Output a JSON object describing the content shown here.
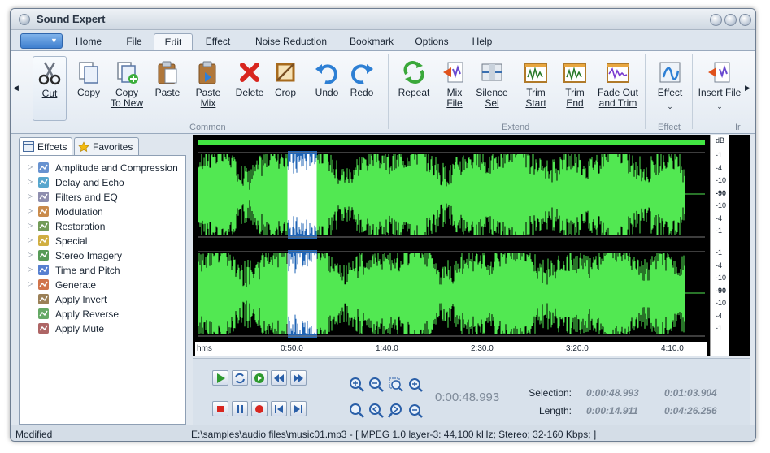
{
  "window": {
    "title": "Sound Expert"
  },
  "menu": {
    "tabs": [
      {
        "label": "Home"
      },
      {
        "label": "File"
      },
      {
        "label": "Edit"
      },
      {
        "label": "Effect"
      },
      {
        "label": "Noise Reduction"
      },
      {
        "label": "Bookmark"
      },
      {
        "label": "Options"
      },
      {
        "label": "Help"
      }
    ],
    "active_tab": "Edit"
  },
  "ribbon": {
    "buttons": [
      {
        "label": "Cut",
        "icon": "scissors-icon"
      },
      {
        "label": "Copy",
        "icon": "copy-icon"
      },
      {
        "label": "Copy To New",
        "line1": "Copy",
        "line2": "To New",
        "icon": "copy-to-new-icon"
      },
      {
        "label": "Paste",
        "icon": "paste-icon"
      },
      {
        "label": "Paste Mix",
        "line1": "Paste",
        "line2": "Mix",
        "icon": "paste-mix-icon"
      },
      {
        "label": "Delete",
        "icon": "delete-icon"
      },
      {
        "label": "Crop",
        "icon": "crop-icon"
      },
      {
        "label": "Undo",
        "icon": "undo-icon"
      },
      {
        "label": "Redo",
        "icon": "redo-icon"
      },
      {
        "label": "Repeat",
        "icon": "repeat-icon"
      },
      {
        "label": "Mix File",
        "line1": "Mix",
        "line2": "File",
        "icon": "mix-file-icon"
      },
      {
        "label": "Silence Sel",
        "line1": "Silence",
        "line2": "Sel",
        "icon": "silence-icon"
      },
      {
        "label": "Trim Start",
        "line1": "Trim",
        "line2": "Start",
        "icon": "trim-start-icon"
      },
      {
        "label": "Trim End",
        "line1": "Trim",
        "line2": "End",
        "icon": "trim-end-icon"
      },
      {
        "label": "Fade Out and Trim",
        "line1": "Fade Out",
        "line2": "and Trim",
        "icon": "fade-out-icon"
      },
      {
        "label": "Effect",
        "icon": "effect-icon"
      },
      {
        "label": "Insert File",
        "icon": "insert-file-icon"
      }
    ],
    "groups": [
      {
        "label": "Common"
      },
      {
        "label": "Extend"
      },
      {
        "label": "Effect"
      },
      {
        "label": "Ir"
      }
    ]
  },
  "side_panel": {
    "tabs": [
      {
        "label": "Effcets"
      },
      {
        "label": "Favorites"
      }
    ],
    "tree": [
      {
        "label": "Amplitude and Compression",
        "expandable": true,
        "icon": "amplitude-icon"
      },
      {
        "label": "Delay and Echo",
        "expandable": true,
        "icon": "delay-icon"
      },
      {
        "label": "Filters and EQ",
        "expandable": true,
        "icon": "filter-icon"
      },
      {
        "label": "Modulation",
        "expandable": true,
        "icon": "modulation-icon"
      },
      {
        "label": "Restoration",
        "expandable": true,
        "icon": "restoration-icon"
      },
      {
        "label": "Special",
        "expandable": true,
        "icon": "special-icon"
      },
      {
        "label": "Stereo Imagery",
        "expandable": true,
        "icon": "stereo-icon"
      },
      {
        "label": "Time and Pitch",
        "expandable": true,
        "icon": "time-pitch-icon"
      },
      {
        "label": "Generate",
        "expandable": true,
        "icon": "generate-icon"
      },
      {
        "label": "Apply Invert",
        "expandable": false,
        "icon": "invert-icon"
      },
      {
        "label": "Apply Reverse",
        "expandable": false,
        "icon": "reverse-icon"
      },
      {
        "label": "Apply Mute",
        "expandable": false,
        "icon": "mute-icon"
      }
    ]
  },
  "waveform": {
    "timeline": [
      "hms",
      "0:50.0",
      "1:40.0",
      "2:30.0",
      "3:20.0",
      "4:10.0"
    ],
    "db_header": "dB",
    "db_scale_top": [
      "-1",
      "-4",
      "-10",
      "-90",
      "-10",
      "-4",
      "-1"
    ],
    "db_scale_bottom": [
      "-1",
      "-4",
      "-10",
      "-90",
      "-10",
      "-4",
      "-1"
    ],
    "wave_color": "#52e852",
    "selection_color": "#1e63b5"
  },
  "transport": {
    "position": "0:00:48.993",
    "selection_label": "Selection:",
    "length_label": "Length:",
    "selection_start": "0:00:48.993",
    "selection_end": "0:01:03.904",
    "selection_length": "0:00:14.911",
    "total_length": "0:04:26.256"
  },
  "status": {
    "state": "Modified",
    "file_info": "E:\\samples\\audio files\\music01.mp3 - [ MPEG 1.0 layer-3: 44,100 kHz; Stereo; 32-160 Kbps; ]"
  }
}
